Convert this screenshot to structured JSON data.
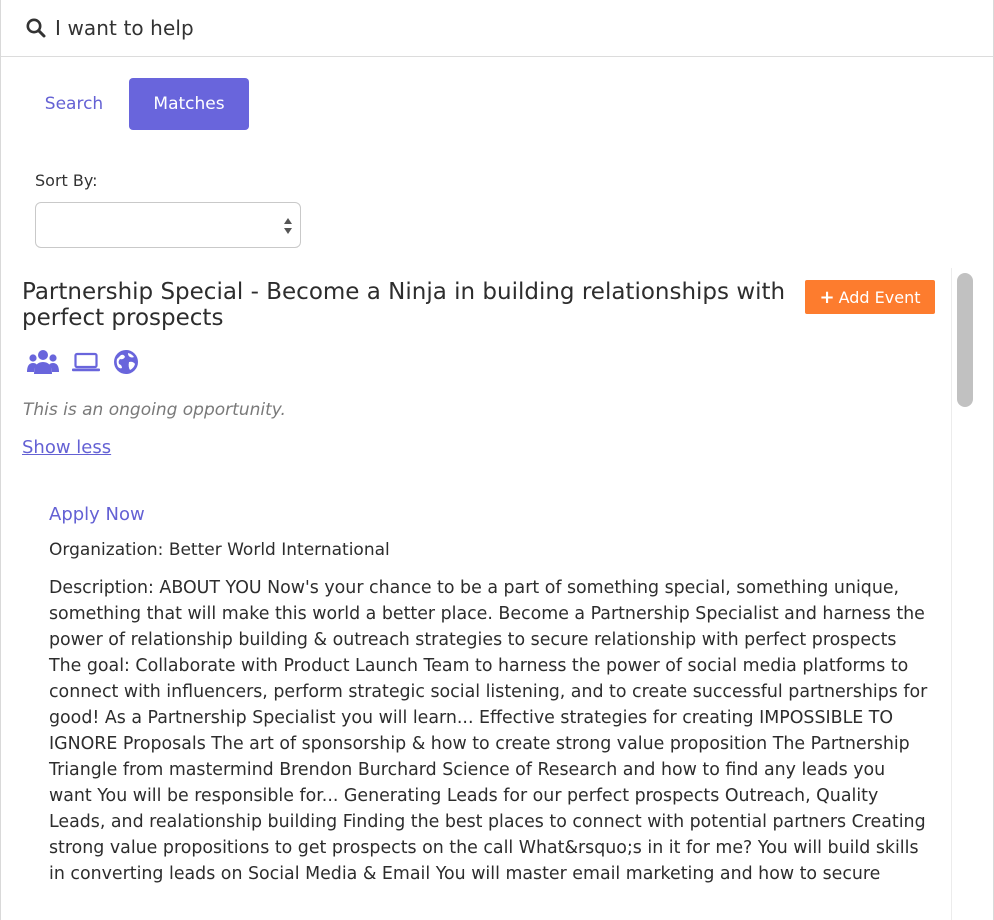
{
  "header": {
    "title": "I want to help",
    "icon": "search-icon"
  },
  "tabs": [
    {
      "label": "Search",
      "active": false
    },
    {
      "label": "Matches",
      "active": true
    }
  ],
  "sort": {
    "label": "Sort By:",
    "selected": ""
  },
  "opportunity": {
    "title": "Partnership Special - Become a Ninja in building relationships with perfect prospects",
    "add_event_label": "Add Event",
    "icons": [
      "group-icon",
      "laptop-icon",
      "globe-icon"
    ],
    "ongoing_text": "This is an ongoing opportunity.",
    "show_less_label": "Show less",
    "apply_label": "Apply Now",
    "organization": "Organization: Better World International",
    "description": "Description: ABOUT YOU Now's your chance to be a part of something special, something unique, something that will make this world a better place. Become a Partnership Specialist and harness the power of relationship building & outreach strategies to secure relationship with perfect prospects The goal: Collaborate with Product Launch Team to harness the power of social media platforms to connect with influencers, perform strategic social listening, and to create successful partnerships for good! As a Partnership Specialist you will learn... Effective strategies for creating IMPOSSIBLE TO IGNORE Proposals The art of sponsorship & how to create strong value proposition The Partnership Triangle from mastermind Brendon Burchard Science of Research and how to find any leads you want You will be responsible for... Generating Leads for our perfect prospects Outreach, Quality Leads, and realationship building Finding the best places to connect with potential partners Creating strong value propositions to get prospects on the call What&rsquo;s in it for me? You will build skills in converting leads on Social Media & Email You will master email marketing and how to secure"
  },
  "colors": {
    "accent": "#6965dc",
    "accent_text": "#6461d4",
    "add_event": "#fd7c2e",
    "scroll_thumb": "#c1c1c1"
  }
}
